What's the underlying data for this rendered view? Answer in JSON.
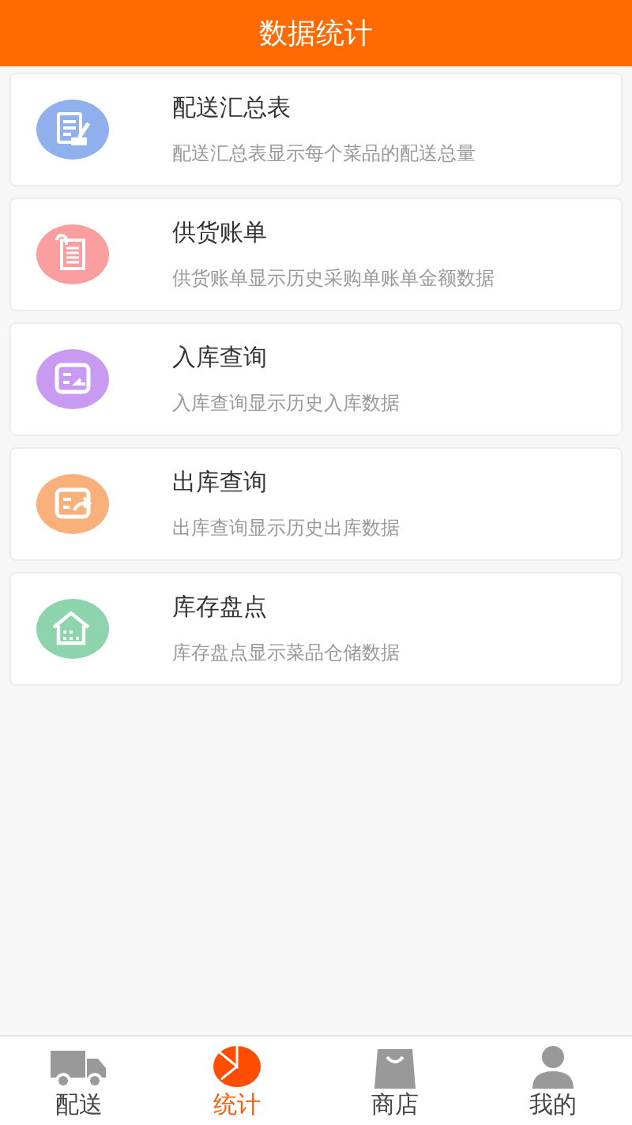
{
  "header": {
    "title": "数据统计"
  },
  "menu_items": [
    {
      "kind": "report",
      "color": "#8fb0ec",
      "title": "配送汇总表",
      "description": "配送汇总表显示每个菜品的配送总量"
    },
    {
      "kind": "bill",
      "color": "#fa9ea0",
      "title": "供货账单",
      "description": "供货账单显示历史采购单账单金额数据"
    },
    {
      "kind": "inbound",
      "color": "#c99af2",
      "title": "入库查询",
      "description": "入库查询显示历史入库数据"
    },
    {
      "kind": "outbound",
      "color": "#f9b07a",
      "title": "出库查询",
      "description": "出库查询显示历史出库数据"
    },
    {
      "kind": "inventory",
      "color": "#8dd3ac",
      "title": "库存盘点",
      "description": "库存盘点显示菜品仓储数据"
    }
  ],
  "tab_bar": [
    {
      "kind": "truck",
      "label": "配送",
      "selected": false
    },
    {
      "kind": "pie",
      "label": "统计",
      "selected": true
    },
    {
      "kind": "bag",
      "label": "商店",
      "selected": false
    },
    {
      "kind": "person",
      "label": "我的",
      "selected": false
    }
  ]
}
